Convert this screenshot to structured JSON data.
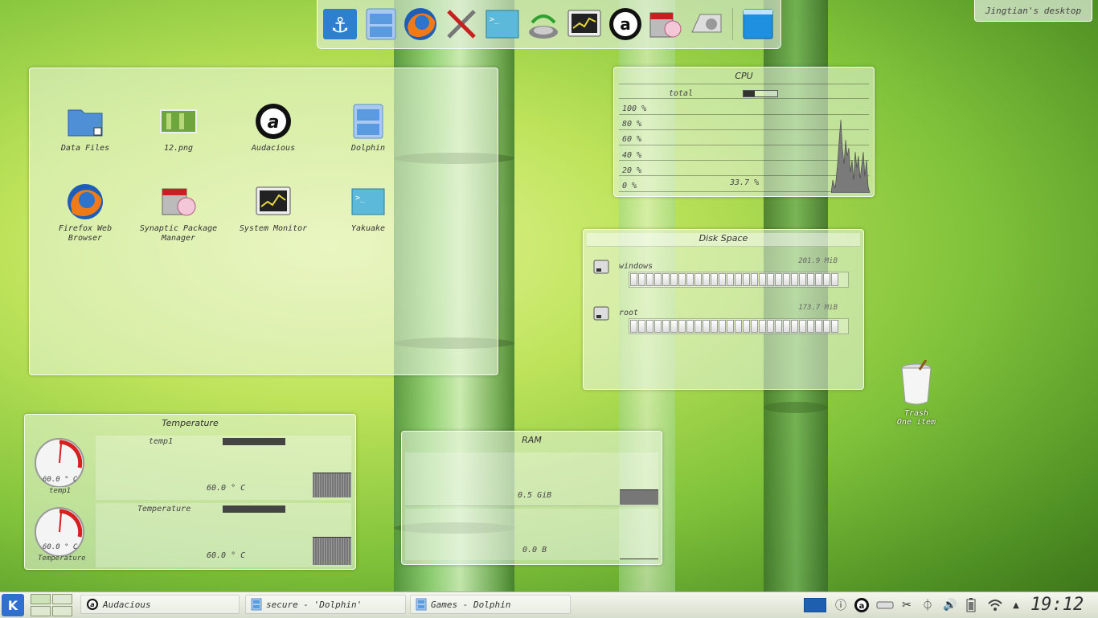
{
  "desktop": {
    "name": "Jingtian's desktop"
  },
  "dock": {
    "items": [
      {
        "name": "anchor-launcher"
      },
      {
        "name": "file-cabinet-launcher"
      },
      {
        "name": "firefox-launcher"
      },
      {
        "name": "system-settings-launcher"
      },
      {
        "name": "terminal-launcher"
      },
      {
        "name": "network-launcher"
      },
      {
        "name": "system-monitor-launcher"
      },
      {
        "name": "audacious-launcher"
      },
      {
        "name": "package-manager-launcher"
      },
      {
        "name": "disk-utility-launcher"
      },
      {
        "name": "desktop-launcher"
      }
    ]
  },
  "folder": {
    "items": [
      {
        "label": "Data Files",
        "icon": "folder-icon"
      },
      {
        "label": "12.png",
        "icon": "image-icon"
      },
      {
        "label": "Audacious",
        "icon": "audacious-icon"
      },
      {
        "label": "Dolphin",
        "icon": "dolphin-icon"
      },
      {
        "label": "Firefox Web Browser",
        "icon": "firefox-icon"
      },
      {
        "label": "Synaptic Package Manager",
        "icon": "package-icon"
      },
      {
        "label": "System Monitor",
        "icon": "monitor-icon"
      },
      {
        "label": "Yakuake",
        "icon": "terminal-icon"
      }
    ]
  },
  "cpu": {
    "title": "CPU",
    "series_label": "total",
    "axis": [
      "100 %",
      "80 %",
      "60 %",
      "40 %",
      "20 %",
      "0 %"
    ],
    "value_text": "33.7 %",
    "usage_fraction": 0.337
  },
  "disk": {
    "title": "Disk Space",
    "drives": [
      {
        "label": "windows",
        "size": "201.9 MiB",
        "fill_fraction": 0.95
      },
      {
        "label": "root",
        "size": "173.7 MiB",
        "fill_fraction": 0.97
      }
    ]
  },
  "temperature": {
    "title": "Temperature",
    "sensors": [
      {
        "label": "temp1",
        "value": "60.0 ° C",
        "gauge_label": "temp1"
      },
      {
        "label": "Temperature",
        "value": "60.0 ° C",
        "gauge_label": "Temperature"
      }
    ]
  },
  "ram": {
    "title": "RAM",
    "rows": [
      {
        "value": "0.5 GiB"
      },
      {
        "value": "0.0 B"
      }
    ]
  },
  "trash": {
    "label": "Trash",
    "sublabel": "One item"
  },
  "taskbar": {
    "tasks": [
      {
        "label": "Audacious"
      },
      {
        "label": "secure - 'Dolphin'"
      },
      {
        "label": "Games - Dolphin"
      }
    ],
    "clock": "19:12"
  },
  "colors": {
    "accent_red": "#d62020",
    "window_blue": "#1f6fc8"
  }
}
